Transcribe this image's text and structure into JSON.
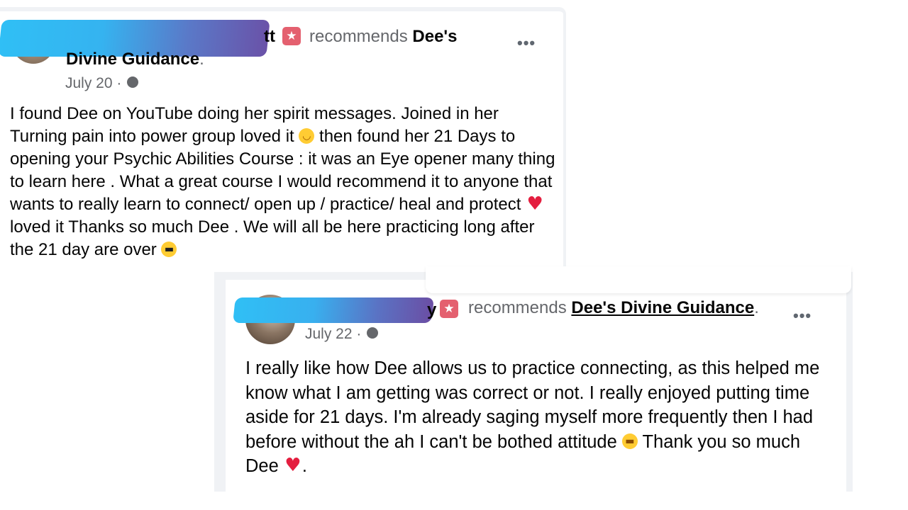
{
  "posts": [
    {
      "name_tail": "tt",
      "recommends_label": "recommends",
      "page_name_part1": "Dee's",
      "page_name_part2": "Divine Guidance",
      "period": ".",
      "date": "July 20 ·",
      "more_label": "•••",
      "body": {
        "seg1": "I found Dee on YouTube doing her spirit messages. Joined in her Turning pain into power group loved it ",
        "seg2": " then found her 21 Days to opening your Psychic Abilities Course : it was an Eye opener many thing to learn here . What a great course I would recommend it to anyone that wants to really learn to connect/ open up / practice/ heal and protect ",
        "seg3": " loved it Thanks so much Dee . We will all be here practicing long after the 21 day are over "
      }
    },
    {
      "name_tail": "y",
      "recommends_label": "recommends",
      "page_name": "Dee's Divine Guidance",
      "period": ".",
      "date": "July 22 ·",
      "more_label": "•••",
      "body": {
        "seg1": "I really like how Dee allows us to  practice connecting, as this helped me know what I am getting was correct or not. I really enjoyed putting time aside for 21 days. I'm already saging myself more frequently then I had before without the ah I can't be bothed attitude ",
        "seg2": " Thank you so much Dee ",
        "seg3": "."
      }
    }
  ],
  "icons": {
    "badge": "recommend-badge-icon",
    "globe": "globe-icon",
    "emoji": [
      "smiling-face-emoji",
      "red-heart-emoji",
      "sunglasses-face-emoji",
      "grinning-face-emoji"
    ]
  },
  "colors": {
    "secondary_text": "#65676b",
    "badge": "#e4606f",
    "heart": "#e41e3f",
    "redaction_start": "#30bff5",
    "redaction_end": "#6a52a8"
  }
}
